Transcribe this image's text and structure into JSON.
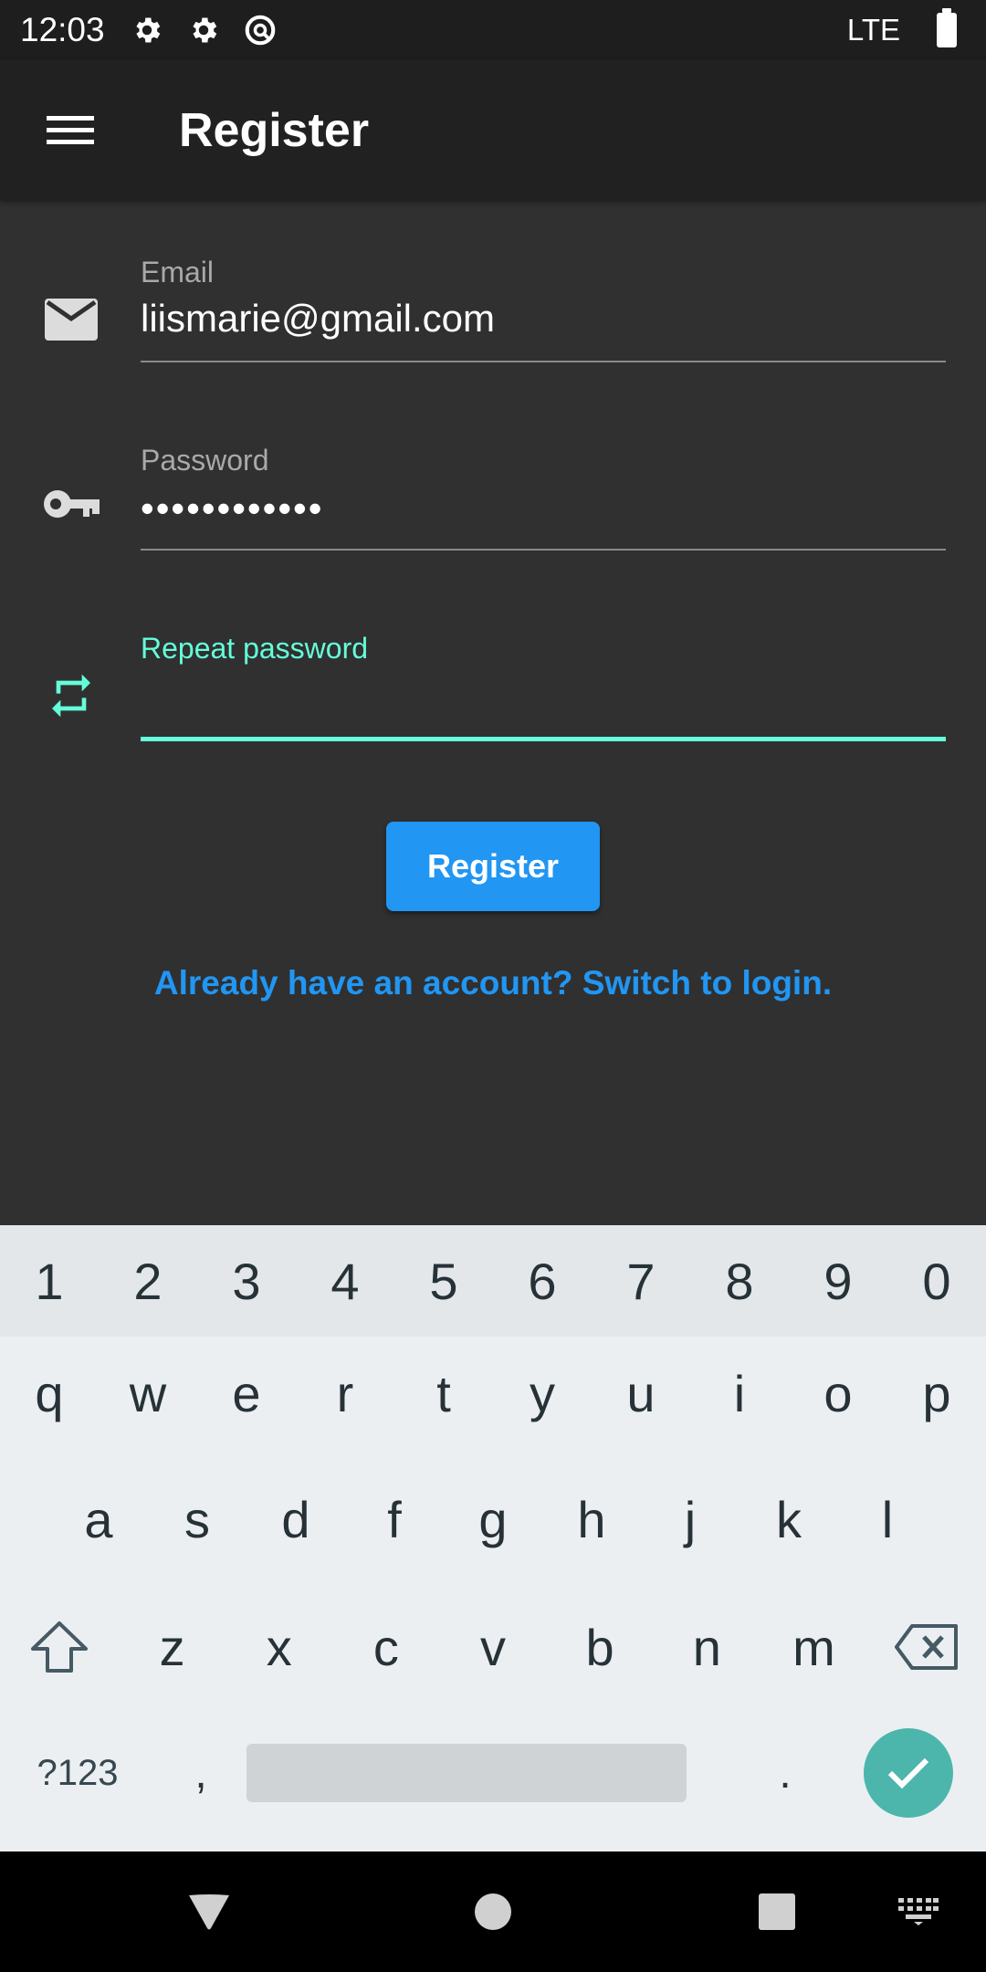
{
  "status_bar": {
    "time": "12:03",
    "network": "LTE",
    "icons": [
      "gear-icon",
      "gear-icon",
      "data-saver-icon",
      "battery-icon"
    ]
  },
  "app_bar": {
    "title": "Register",
    "menu_icon": "hamburger-menu-icon"
  },
  "form": {
    "email": {
      "label": "Email",
      "value": "liismarie@gmail.com",
      "icon": "mail-icon"
    },
    "password": {
      "label": "Password",
      "value": "••••••••••••",
      "icon": "key-icon"
    },
    "repeat_password": {
      "label": "Repeat password",
      "value": "",
      "icon": "repeat-icon",
      "focused": true
    },
    "register_button": "Register",
    "switch_link": "Already have an account? Switch to login."
  },
  "keyboard": {
    "numbers": [
      "1",
      "2",
      "3",
      "4",
      "5",
      "6",
      "7",
      "8",
      "9",
      "0"
    ],
    "row1": [
      "q",
      "w",
      "e",
      "r",
      "t",
      "y",
      "u",
      "i",
      "o",
      "p"
    ],
    "row2": [
      "a",
      "s",
      "d",
      "f",
      "g",
      "h",
      "j",
      "k",
      "l"
    ],
    "row3": [
      "z",
      "x",
      "c",
      "v",
      "b",
      "n",
      "m"
    ],
    "symbols_key": "?123",
    "comma_key": ",",
    "period_key": "."
  },
  "colors": {
    "accent": "#64ffda",
    "primary": "#2196f3",
    "background": "#303030",
    "app_bar": "#212121",
    "enter_key": "#4db6ac"
  }
}
